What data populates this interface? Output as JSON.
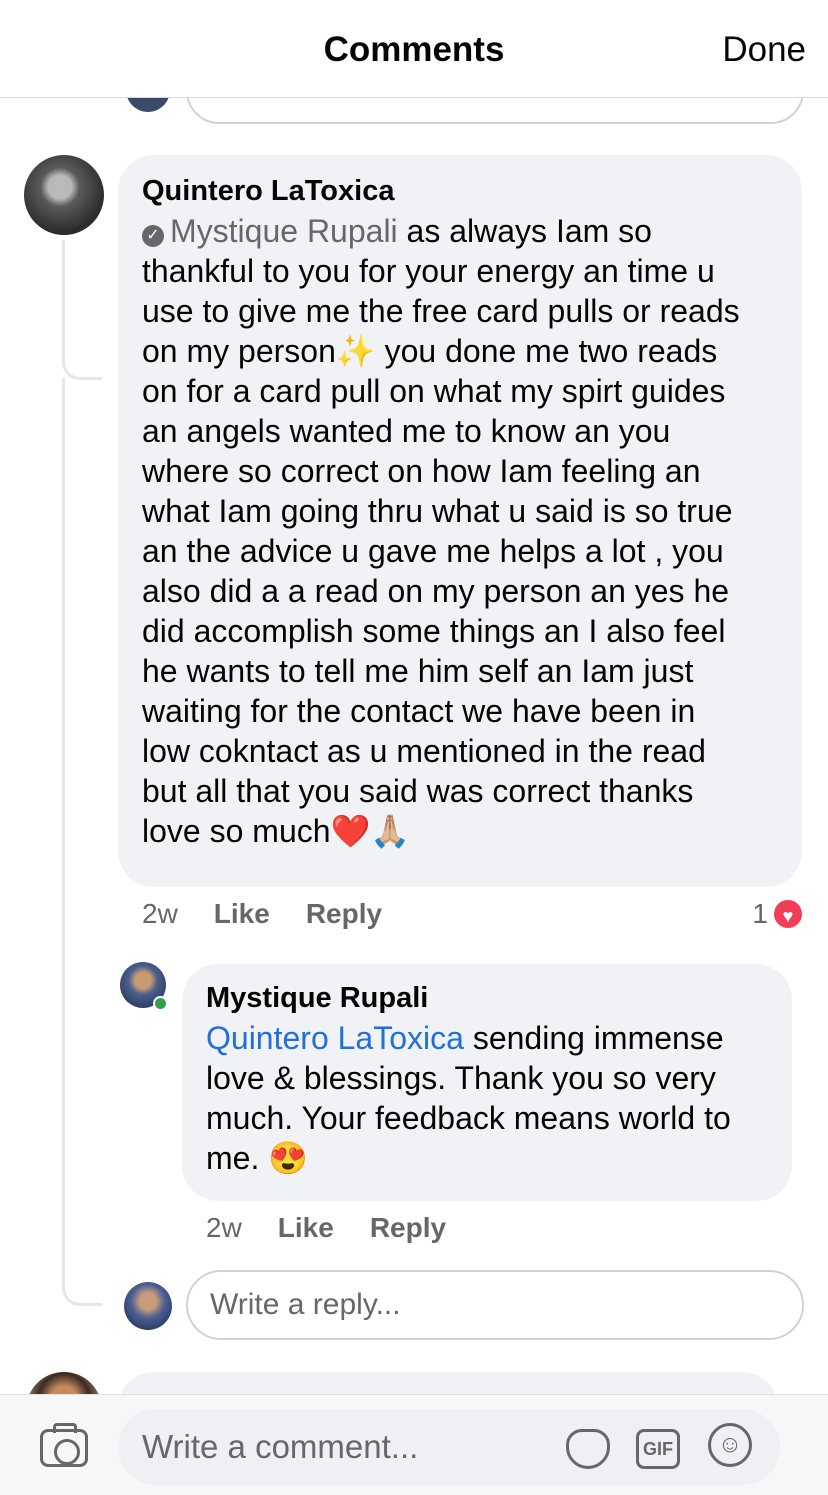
{
  "header": {
    "title": "Comments",
    "done_label": "Done"
  },
  "comment": {
    "author": "Quintero LaToxica",
    "mention": "Mystique Rupali",
    "lines": [
      " as always Iam so",
      "thankful to you for your energy an time u",
      "use to give me the free card pulls or reads",
      "on my person",
      " you done me two reads",
      "on for a card pull on what my spirt guides",
      "an angels wanted me to know an you",
      "where so correct on how Iam feeling an",
      "what Iam going thru what u said is so true",
      "an the advice u gave me helps a lot , you",
      "also did a a read on my person an yes he",
      "did accomplish some things an I also feel",
      "he wants to tell me him self an Iam just",
      "waiting for the contact we have been in",
      "low cokntact as u mentioned in the read",
      "but all that you said was correct thanks",
      "love so much"
    ],
    "emojis": {
      "sparkle": "✨",
      "heart": "❤️",
      "pray": "🙏🏼"
    },
    "time": "2w",
    "like_label": "Like",
    "reply_label": "Reply",
    "reaction_count": "1"
  },
  "reply": {
    "author": "Mystique Rupali",
    "mention": "Quintero LaToxica",
    "text1": " sending immense",
    "text2": "love & blessings. Thank you so very",
    "text3": "much. Your feedback means world to",
    "text4": "me. ",
    "emoji": "😍",
    "time": "2w",
    "like_label": "Like",
    "reply_label": "Reply"
  },
  "reply_composer": {
    "placeholder": "Write a reply..."
  },
  "footer": {
    "placeholder": "Write a comment...",
    "gif_label": "GIF",
    "smile_glyph": "☺"
  }
}
